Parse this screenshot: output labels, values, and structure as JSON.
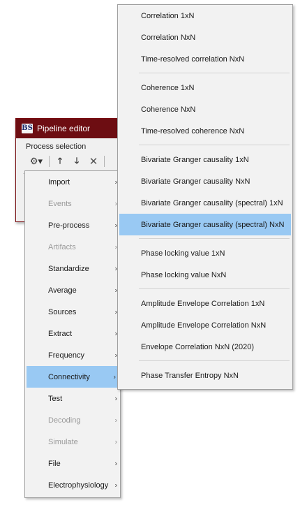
{
  "window": {
    "logo": "BS",
    "title": "Pipeline editor",
    "section_label": "Process selection"
  },
  "toolbar": {
    "gear_glyph": "⚙▾",
    "up_glyph": "🡑",
    "down_glyph": "🡓",
    "delete_glyph": "✕"
  },
  "menu": {
    "arrow_glyph": "›",
    "items": [
      {
        "label": "Import",
        "disabled": false
      },
      {
        "label": "Events",
        "disabled": true
      },
      {
        "label": "Pre-process",
        "disabled": false
      },
      {
        "label": "Artifacts",
        "disabled": true
      },
      {
        "label": "Standardize",
        "disabled": false
      },
      {
        "label": "Average",
        "disabled": false
      },
      {
        "label": "Sources",
        "disabled": false
      },
      {
        "label": "Extract",
        "disabled": false
      },
      {
        "label": "Frequency",
        "disabled": false
      },
      {
        "label": "Connectivity",
        "disabled": false,
        "highlighted": true
      },
      {
        "label": "Test",
        "disabled": false
      },
      {
        "label": "Decoding",
        "disabled": true
      },
      {
        "label": "Simulate",
        "disabled": true
      },
      {
        "label": "File",
        "disabled": false
      },
      {
        "label": "Electrophysiology",
        "disabled": false
      }
    ]
  },
  "submenu": {
    "groups": [
      [
        "Correlation 1xN",
        "Correlation NxN",
        "Time-resolved correlation NxN"
      ],
      [
        "Coherence 1xN",
        "Coherence NxN",
        "Time-resolved coherence NxN"
      ],
      [
        "Bivariate Granger causality 1xN",
        "Bivariate Granger causality NxN",
        "Bivariate Granger causality (spectral) 1xN",
        "Bivariate Granger causality (spectral) NxN"
      ],
      [
        "Phase locking value 1xN",
        "Phase locking value NxN"
      ],
      [
        "Amplitude Envelope Correlation 1xN",
        "Amplitude Envelope Correlation NxN",
        "Envelope Correlation NxN (2020)"
      ],
      [
        "Phase Transfer Entropy NxN"
      ]
    ],
    "highlighted": "Bivariate Granger causality (spectral) NxN"
  },
  "colors": {
    "titlebar": "#6d0d12",
    "highlight": "#99c9f3",
    "menu_bg": "#f2f2f2",
    "disabled_text": "#9a9a9a"
  }
}
